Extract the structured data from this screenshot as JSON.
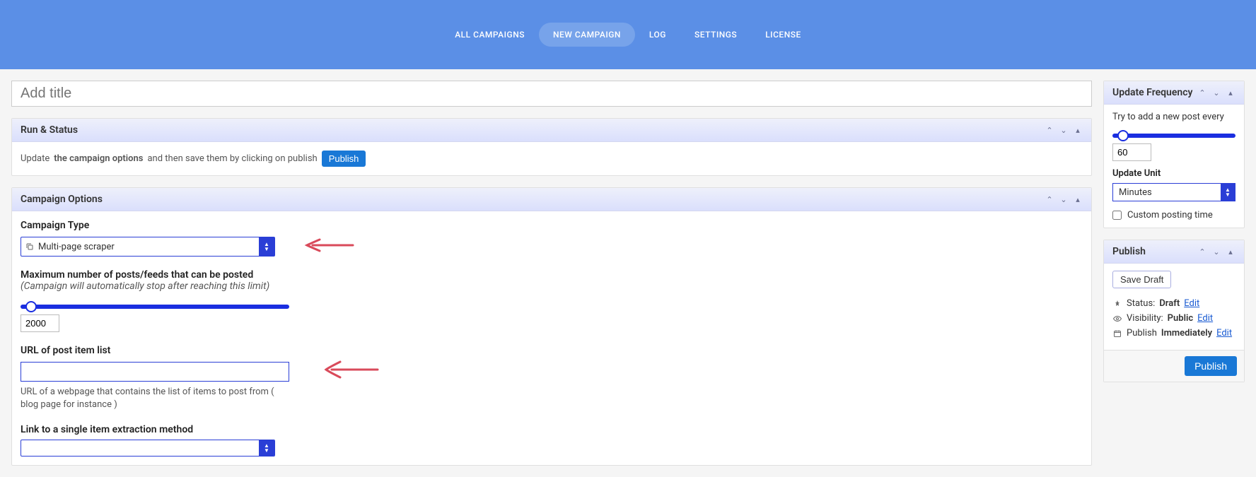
{
  "header": {
    "tabs": [
      {
        "label": "ALL CAMPAIGNS",
        "active": false
      },
      {
        "label": "NEW CAMPAIGN",
        "active": true
      },
      {
        "label": "LOG",
        "active": false
      },
      {
        "label": "SETTINGS",
        "active": false
      },
      {
        "label": "LICENSE",
        "active": false
      }
    ]
  },
  "title": {
    "placeholder": "Add title",
    "value": ""
  },
  "panels": {
    "run_status": {
      "title": "Run & Status",
      "update_prefix": "Update",
      "strong_text": "the campaign options",
      "update_suffix": "and then save them by clicking on publish",
      "publish_btn": "Publish"
    },
    "campaign_options": {
      "title": "Campaign Options",
      "type_label": "Campaign Type",
      "type_value": "Multi-page scraper",
      "max_label": "Maximum number of posts/feeds that can be posted",
      "max_hint": "(Campaign will automatically stop after reaching this limit)",
      "max_value": "2000",
      "url_label": "URL of post item list",
      "url_value": "",
      "url_help": "URL of a webpage that contains the list of items to post from ( blog page for instance )",
      "link_label": "Link to a single item extraction method"
    }
  },
  "sidebar": {
    "update_frequency": {
      "title": "Update Frequency",
      "try_label": "Try to add a new post every",
      "value": "60",
      "unit_label": "Update Unit",
      "unit_value": "Minutes",
      "custom_label": "Custom posting time"
    },
    "publish": {
      "title": "Publish",
      "save_draft": "Save Draft",
      "status_label": "Status:",
      "status_value": "Draft",
      "visibility_label": "Visibility:",
      "visibility_value": "Public",
      "publish_label": "Publish",
      "publish_value": "Immediately",
      "edit_label": "Edit",
      "publish_btn": "Publish"
    }
  }
}
